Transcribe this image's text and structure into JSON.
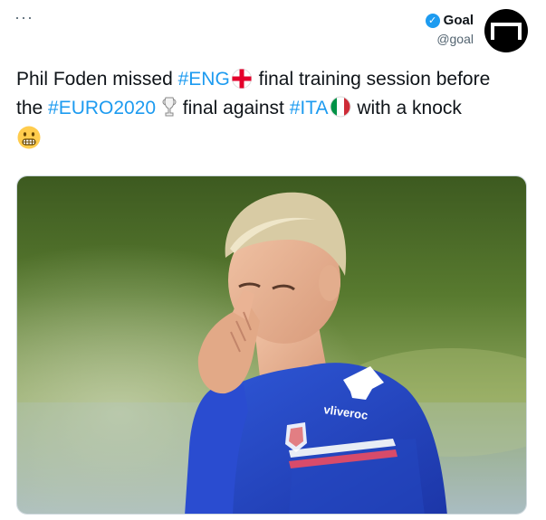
{
  "header": {
    "more_label": "···",
    "author_name": "Goal",
    "author_handle": "@goal",
    "verified": true
  },
  "tweet": {
    "seg1": "Phil Foden missed ",
    "tag1": "#ENG",
    "seg2": " final training session before",
    "seg3": "the ",
    "tag2": "#EURO2020",
    "seg4": " final against ",
    "tag3": "#ITA",
    "seg5": " with a knock"
  },
  "media": {
    "jersey_text": "vliveroc"
  },
  "colors": {
    "link": "#1d9bf0",
    "verified": "#1d9bf0",
    "text": "#0f1419",
    "secondary": "#536471"
  },
  "icons": [
    "more-icon",
    "verified-icon",
    "goal-logo",
    "england-flag-icon",
    "trophy-icon",
    "italy-flag-icon",
    "grimacing-face-icon"
  ]
}
